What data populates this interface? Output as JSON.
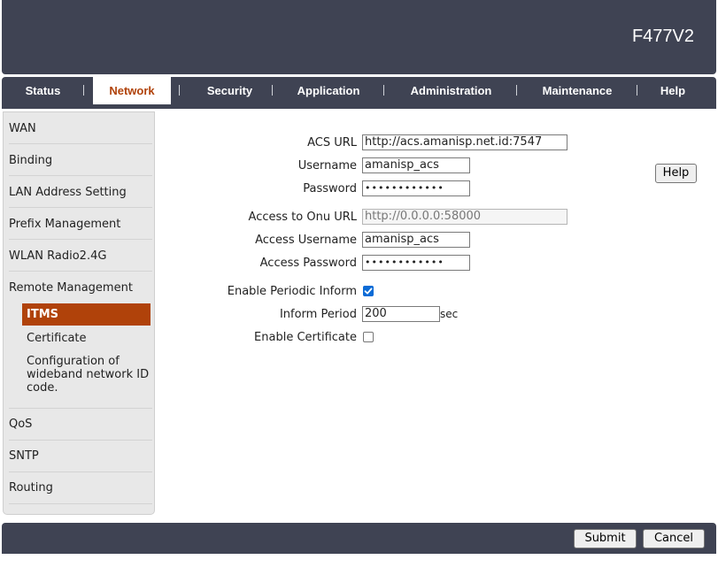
{
  "header": {
    "model": "F477V2"
  },
  "nav": {
    "tabs": [
      {
        "label": "Status"
      },
      {
        "label": "Network"
      },
      {
        "label": "Security"
      },
      {
        "label": "Application"
      },
      {
        "label": "Administration"
      },
      {
        "label": "Maintenance"
      },
      {
        "label": "Help"
      }
    ],
    "active": "Network"
  },
  "sidebar": {
    "items": [
      {
        "label": "WAN"
      },
      {
        "label": "Binding"
      },
      {
        "label": "LAN Address Setting"
      },
      {
        "label": "Prefix Management"
      },
      {
        "label": "WLAN Radio2.4G"
      },
      {
        "label": "Remote Management"
      },
      {
        "label": "QoS"
      },
      {
        "label": "SNTP"
      },
      {
        "label": "Routing"
      }
    ],
    "subitems": [
      {
        "label": "ITMS",
        "active": true
      },
      {
        "label": "Certificate"
      },
      {
        "label": "Configuration of wideband network ID code."
      }
    ]
  },
  "form": {
    "acs_url": {
      "label": "ACS URL",
      "value": "http://acs.amanisp.net.id:7547"
    },
    "username": {
      "label": "Username",
      "value": "amanisp_acs"
    },
    "password": {
      "label": "Password",
      "value": "••••••••••••"
    },
    "onu_url": {
      "label": "Access to Onu URL",
      "value": "http://0.0.0.0:58000"
    },
    "access_username": {
      "label": "Access Username",
      "value": "amanisp_acs"
    },
    "access_password": {
      "label": "Access Password",
      "value": "••••••••••••"
    },
    "periodic_inform": {
      "label": "Enable Periodic Inform",
      "checked": true
    },
    "inform_period": {
      "label": "Inform Period",
      "value": "200",
      "unit": "sec"
    },
    "enable_certificate": {
      "label": "Enable Certificate",
      "checked": false
    }
  },
  "help_button": "Help",
  "footer": {
    "submit": "Submit",
    "cancel": "Cancel"
  },
  "colors": {
    "bar": "#3f4353",
    "accent": "#b0420a",
    "check": "#0b6bd6"
  }
}
